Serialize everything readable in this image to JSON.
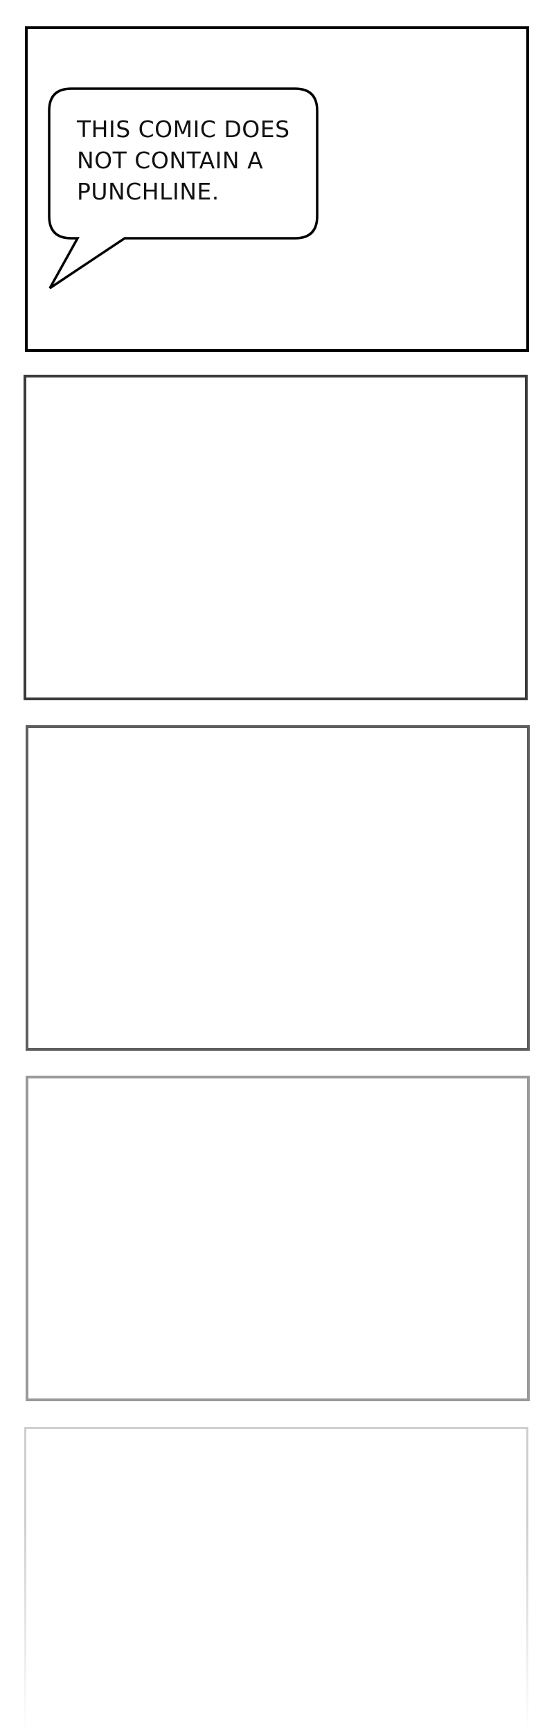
{
  "comic": {
    "speech_bubble": {
      "lines": [
        "THIS COMIC DOES",
        "NOT CONTAIN A",
        "PUNCHLINE."
      ]
    },
    "panels": [
      {
        "name": "panel-1",
        "border_color": "#000000"
      },
      {
        "name": "panel-2",
        "border_color": "#3a3a3a"
      },
      {
        "name": "panel-3",
        "border_color": "#5e5e5e"
      },
      {
        "name": "panel-4",
        "border_color": "#9a9a9a"
      },
      {
        "name": "panel-5",
        "border_color": "#cfcfcf"
      }
    ]
  }
}
